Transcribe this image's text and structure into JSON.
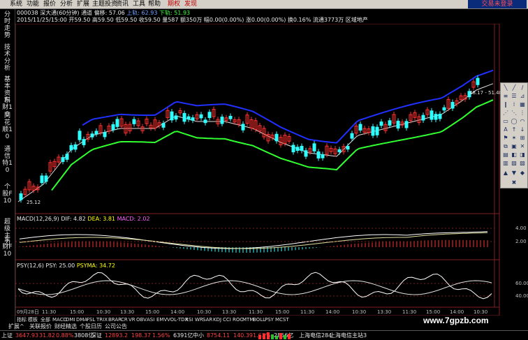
{
  "menu": {
    "items": [
      "系统",
      "功能",
      "报价",
      "分析",
      "扩展",
      "主题投资",
      "资讯",
      "工具",
      "帮助",
      "期权",
      "发现"
    ],
    "trade": "交易未登录"
  },
  "left_tabs": [
    "分时走势",
    "技术分析",
    "基本资料",
    "东财10",
    "同花顺10",
    "通信特10",
    "个股F10",
    "超级主力",
    "东财F10"
  ],
  "info": {
    "line1": {
      "code": "000038 深大通(60分钟)",
      "ind": "通道",
      "mid_label": "偏移: 57.06",
      "up_label": "上轨: 62.93",
      "down_label": "下轨: 51.93"
    },
    "line2": {
      "date": "2015/11/25/15:00",
      "open": "开59.50",
      "high": "高59.50",
      "low": "低59.50",
      "close": "收59.50",
      "vol": "量587",
      "amt": "额350万",
      "amp": "幅0.00(0.00%)",
      "chg": "涨0.00(0.00%)",
      "turn": "换0.16%",
      "float": "流通3773万",
      "sector": "区域地产"
    }
  },
  "price_labels": {
    "low_mark": "25.12",
    "high_mark": "48.17 - 51.48"
  },
  "macd": {
    "title": "MACD(12,26,9)",
    "dif": "DIF: 4.82",
    "dea": "DEA: 3.81",
    "macd": "MACD: 2.02",
    "y_labels": [
      "4.00",
      "2.00"
    ]
  },
  "psy": {
    "title": "PSY(12,6)",
    "psy": "PSY: 25.00",
    "psyma": "PSYMA: 34.72",
    "y_labels": [
      "60.00",
      "40.00"
    ]
  },
  "time_axis": [
    "09月28日",
    "11:30",
    "15:00",
    "10:30",
    "13:30",
    "15:00",
    "14:00",
    "10:30",
    "13:30",
    "11:30",
    "15:00",
    "11:30",
    "14:00",
    "10:30",
    "13:30",
    "11:30",
    "15:00",
    "14:00",
    "10:30"
  ],
  "indicator_tabs": [
    "指标",
    "模板",
    "全部",
    "MACD",
    "DMI",
    "DMA",
    "FSL",
    "TRIX",
    "BRAR",
    "CR",
    "VR",
    "OBV",
    "ASI",
    "EMV",
    "VOL-TDX",
    "RSI",
    "WR",
    "SAR",
    "KDJ",
    "CCI",
    "ROC",
    "MTM",
    "BOLL",
    "PSY",
    "MCST"
  ],
  "sub_tabs": [
    "扩展^",
    "关联报价",
    "财经精选",
    "个股日历",
    "公司公告"
  ],
  "status": {
    "sh_label": "上证",
    "sh_value": "3647.93",
    "sh_chg": "31.82",
    "sh_pct": "0.88%",
    "sh_amt": "3808亿",
    "sz_label": "深证",
    "sz_value": "12893.2",
    "sz_chg": "198.37",
    "sz_pct": "1.56%",
    "sz_amt": "6391亿",
    "zx_label": "中小",
    "zx_value": "8754.11",
    "zx_chg": "140.39",
    "zx_pct": "1.63%",
    "zx_amt": "2856亿",
    "conn1": "上海电信284",
    "conn2": "上海电信主站3"
  },
  "watermark": "www.7gpzb.com",
  "colors": {
    "up": "#ff3030",
    "down": "#30ffff",
    "upper_band": "#2030ff",
    "lower_band": "#30ff30",
    "mid_band": "#e0e0e0"
  }
}
